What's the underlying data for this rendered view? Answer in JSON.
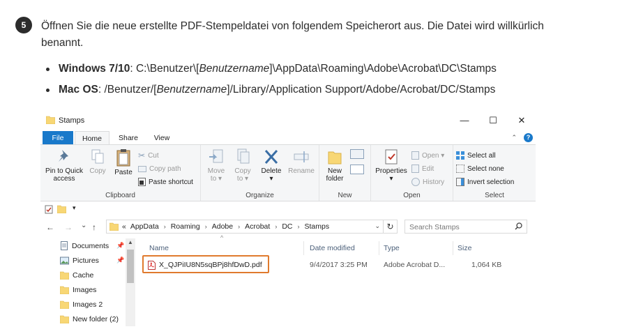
{
  "step": {
    "number": "5",
    "text": "Öffnen Sie die neue erstellte PDF-Stempeldatei von folgendem Speicherort aus. Die Datei wird willkürlich benannt."
  },
  "bullets": [
    {
      "label": "Windows 7/10",
      "sep": ": ",
      "path_pre": "C:\\Benutzer\\[",
      "path_var": "Benutzername",
      "path_post": "]\\AppData\\Roaming\\Adobe\\Acrobat\\DC\\Stamps"
    },
    {
      "label": "Mac OS",
      "sep": ": ",
      "path_pre": "/Benutzer/[",
      "path_var": "Benutzername",
      "path_post": "]/Library/Application Support/Adobe/Acrobat/DC/Stamps"
    }
  ],
  "explorer": {
    "title": "Stamps",
    "window_controls": {
      "minimize": "—",
      "maximize": "☐",
      "close": "✕"
    },
    "tabs": {
      "file": "File",
      "home": "Home",
      "share": "Share",
      "view": "View"
    },
    "help": "?",
    "ribbon": {
      "clipboard": {
        "label": "Clipboard",
        "pin_line1": "Pin to Quick",
        "pin_line2": "access",
        "copy": "Copy",
        "paste": "Paste",
        "cut": "Cut",
        "copy_path": "Copy path",
        "paste_shortcut": "Paste shortcut"
      },
      "organize": {
        "label": "Organize",
        "move_line1": "Move",
        "move_line2": "to ▾",
        "copy_line1": "Copy",
        "copy_line2": "to ▾",
        "delete_line1": "Delete",
        "delete_line2": "▾",
        "rename": "Rename"
      },
      "new": {
        "label": "New",
        "folder_line1": "New",
        "folder_line2": "folder"
      },
      "open": {
        "label": "Open",
        "properties_line1": "Properties",
        "properties_line2": "▾",
        "open": "Open ▾",
        "edit": "Edit",
        "history": "History"
      },
      "select": {
        "label": "Select",
        "all": "Select all",
        "none": "Select none",
        "invert": "Invert selection"
      }
    },
    "qat_dropdown": "▾",
    "nav": {
      "back": "←",
      "forward": "→",
      "recent": "⌄",
      "up": "↑"
    },
    "address": {
      "overflow": "«",
      "crumbs": [
        "AppData",
        "Roaming",
        "Adobe",
        "Acrobat",
        "DC",
        "Stamps"
      ],
      "dropdown": "⌄",
      "refresh": "↻"
    },
    "search_placeholder": "Search Stamps",
    "nav_pane": {
      "items": [
        "Documents",
        "Pictures",
        "Cache",
        "Images",
        "Images 2",
        "New folder (2)"
      ]
    },
    "columns": {
      "name": "Name",
      "date": "Date modified",
      "type": "Type",
      "size": "Size"
    },
    "files": [
      {
        "name": "X_QJPiIU8N5sqBPj8hfDwD.pdf",
        "date": "9/4/2017 3:25 PM",
        "type": "Adobe Acrobat D...",
        "size": "1,064 KB"
      }
    ],
    "colors": {
      "file_tab": "#1979ca",
      "highlight": "#e07a2d",
      "folder": "#f8d775"
    }
  }
}
